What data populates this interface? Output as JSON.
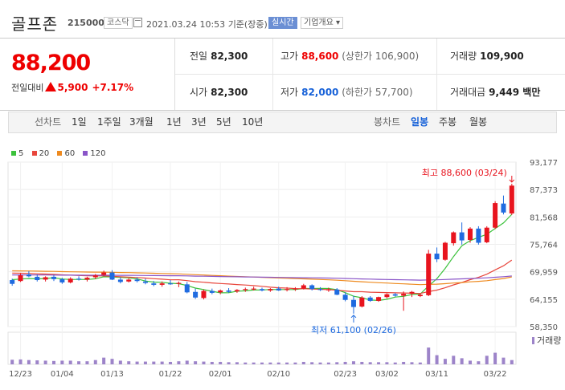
{
  "header": {
    "name": "골프존",
    "code": "215000",
    "market": "코스닥",
    "datetime": "2021.03.24 10:53",
    "status": "기준(장중)",
    "realtime_label": "실시간",
    "company_info_label": "기업개요 ▾"
  },
  "quote": {
    "price": "88,200",
    "compare_label": "전일대비",
    "change": "5,900",
    "change_pct": "+7.17%",
    "prev_close_label": "전일",
    "prev_close": "82,300",
    "high_label": "고가",
    "high": "88,600",
    "upper_limit": "(상한가 106,900)",
    "volume_label": "거래량",
    "volume": "109,900",
    "open_label": "시가",
    "open": "82,300",
    "low_label": "저가",
    "low": "82,000",
    "lower_limit": "(하한가 57,700)",
    "amount_label": "거래대금",
    "amount": "9,449 백만"
  },
  "periods": {
    "line_label": "선차트",
    "line_items": [
      "1일",
      "1주일",
      "3개월",
      "1년",
      "3년",
      "5년",
      "10년"
    ],
    "candle_label": "봉차트",
    "candle_items": [
      "일봉",
      "주봉",
      "월봉"
    ],
    "selected": "일봉"
  },
  "colors": {
    "up": "#e8141e",
    "down": "#1f6be0",
    "ma5": "#3cc23c",
    "ma20": "#e8463c",
    "ma60": "#ee8a1f",
    "ma120": "#8a55c8",
    "volume": "#9d84c9"
  },
  "chart_data": {
    "type": "candlestick",
    "legend": [
      {
        "name": "5",
        "color": "#3cc23c"
      },
      {
        "name": "20",
        "color": "#e8463c"
      },
      {
        "name": "60",
        "color": "#ee8a1f"
      },
      {
        "name": "120",
        "color": "#8a55c8"
      }
    ],
    "y_ticks": [
      "93,177",
      "87,373",
      "81,568",
      "75,764",
      "69,959",
      "64,155",
      "58,350"
    ],
    "ylim": [
      58350,
      93177
    ],
    "x_ticks": [
      {
        "label": "12/23",
        "index": 1
      },
      {
        "label": "01/04",
        "index": 6
      },
      {
        "label": "01/13",
        "index": 12
      },
      {
        "label": "01/22",
        "index": 19
      },
      {
        "label": "02/01",
        "index": 25
      },
      {
        "label": "02/10",
        "index": 32
      },
      {
        "label": "02/23",
        "index": 40
      },
      {
        "label": "03/02",
        "index": 45
      },
      {
        "label": "03/11",
        "index": 51
      },
      {
        "label": "03/22",
        "index": 58
      }
    ],
    "max_annotation": "최고 88,600 (03/24)",
    "min_annotation": "최저 61,100 (02/26)",
    "volume_label": "거래량",
    "candles": [
      [
        68200,
        68500,
        67000,
        67400,
        0.15
      ],
      [
        68000,
        69600,
        67800,
        69200,
        0.16
      ],
      [
        69400,
        70100,
        68800,
        69000,
        0.14
      ],
      [
        68900,
        69400,
        67900,
        68200,
        0.13
      ],
      [
        68300,
        69000,
        67900,
        68800,
        0.12
      ],
      [
        68900,
        69300,
        68000,
        68400,
        0.11
      ],
      [
        68400,
        68700,
        67400,
        67700,
        0.12
      ],
      [
        67700,
        68800,
        67500,
        68500,
        0.12
      ],
      [
        68500,
        69000,
        68100,
        68300,
        0.1
      ],
      [
        68300,
        68900,
        67900,
        68700,
        0.1
      ],
      [
        68800,
        69500,
        68400,
        69200,
        0.14
      ],
      [
        69300,
        70200,
        69000,
        69800,
        0.22
      ],
      [
        69800,
        70300,
        68200,
        68300,
        0.18
      ],
      [
        68300,
        68800,
        67500,
        67800,
        0.12
      ],
      [
        67900,
        68600,
        67700,
        68300,
        0.1
      ],
      [
        68300,
        68800,
        67700,
        68000,
        0.09
      ],
      [
        67900,
        68500,
        67300,
        67600,
        0.09
      ],
      [
        67500,
        68000,
        66900,
        67200,
        0.09
      ],
      [
        67200,
        67900,
        66800,
        67500,
        0.09
      ],
      [
        67500,
        68200,
        67200,
        67300,
        0.08
      ],
      [
        67400,
        67900,
        66700,
        67600,
        0.1
      ],
      [
        67300,
        67800,
        65400,
        65600,
        0.12
      ],
      [
        65700,
        66400,
        64200,
        64500,
        0.1
      ],
      [
        64400,
        66200,
        64100,
        65900,
        0.09
      ],
      [
        65900,
        66400,
        65200,
        65500,
        0.08
      ],
      [
        65600,
        66200,
        65200,
        66000,
        0.08
      ],
      [
        66000,
        66500,
        65500,
        65700,
        0.07
      ],
      [
        65800,
        66300,
        65500,
        66100,
        0.07
      ],
      [
        66100,
        66600,
        65700,
        66300,
        0.06
      ],
      [
        66200,
        66800,
        66000,
        66400,
        0.06
      ],
      [
        66300,
        66600,
        65800,
        66000,
        0.06
      ],
      [
        66000,
        66500,
        65700,
        66300,
        0.06
      ],
      [
        66400,
        66800,
        65900,
        66000,
        0.06
      ],
      [
        66100,
        66700,
        65800,
        66300,
        0.06
      ],
      [
        66300,
        66700,
        65900,
        66400,
        0.06
      ],
      [
        66400,
        67400,
        66200,
        67100,
        0.08
      ],
      [
        67100,
        67300,
        66000,
        66300,
        0.07
      ],
      [
        66300,
        66700,
        65900,
        66100,
        0.06
      ],
      [
        66100,
        66600,
        65700,
        66200,
        0.06
      ],
      [
        66200,
        66500,
        65000,
        65100,
        0.07
      ],
      [
        65100,
        65600,
        63700,
        64000,
        0.08
      ],
      [
        64000,
        64900,
        61100,
        62500,
        0.1
      ],
      [
        62600,
        64800,
        62400,
        64500,
        0.08
      ],
      [
        64500,
        64800,
        63600,
        63800,
        0.07
      ],
      [
        63800,
        64700,
        63600,
        64600,
        0.07
      ],
      [
        64600,
        65400,
        64300,
        65200,
        0.07
      ],
      [
        65200,
        65500,
        64700,
        64900,
        0.06
      ],
      [
        64900,
        65800,
        61700,
        65300,
        0.08
      ],
      [
        65300,
        65900,
        64600,
        65700,
        0.07
      ],
      [
        64800,
        65400,
        64600,
        65100,
        0.06
      ],
      [
        65000,
        74600,
        64800,
        73800,
        0.55
      ],
      [
        73800,
        75100,
        72000,
        72600,
        0.3
      ],
      [
        72500,
        76300,
        72300,
        76100,
        0.18
      ],
      [
        76000,
        78500,
        75500,
        78300,
        0.28
      ],
      [
        78300,
        80400,
        75700,
        76600,
        0.2
      ],
      [
        76700,
        79400,
        76100,
        79100,
        0.12
      ],
      [
        79100,
        79600,
        75700,
        76100,
        0.1
      ],
      [
        76200,
        79600,
        76000,
        79300,
        0.28
      ],
      [
        79300,
        84900,
        79000,
        84500,
        0.38
      ],
      [
        84400,
        86100,
        82100,
        82500,
        0.22
      ],
      [
        82300,
        88600,
        82000,
        88200,
        0.14
      ]
    ]
  }
}
